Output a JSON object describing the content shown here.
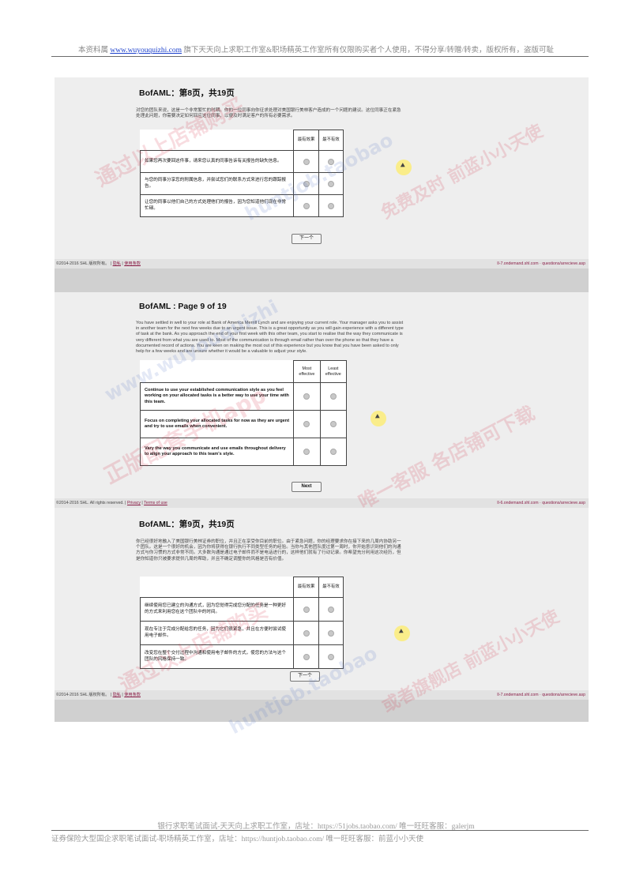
{
  "header": {
    "prefix": "本资料属",
    "link": "www.wuyouquizhi.com",
    "suffix": "旗下天天向上求职工作室&职场精英工作室所有仅限购买者个人使用，不得分享/转赠/转卖，版权所有，盗版可耻"
  },
  "shots": [
    {
      "title": "BofAML：第8页，共19页",
      "intro": "对您的团队来说，这是一个非常繁忙的时期。你的一位同事向你征求处理对美国银行美林客户造成的一个问题的建议。这位同事正在紧急处理此问题，你需要决定如何回应这位同事，以便及时满足客户的所有必要需求。",
      "col_most": "最有效果",
      "col_least": "最不有效",
      "options": [
        "如果您再次要回这件事，请来您认真的同事告诉有关报告的缺失信息。",
        "与您的同事分享您的附属信息，并尝试您们的联系方式来进行您的跟踪报告。",
        "让您的同事以他们自己的方式处理他们的报告，因为您知道他们现在非常忙碌。"
      ],
      "next": "下一个",
      "footer_left": "©2014-2016 SHL  版权所有。",
      "footer_privacy": "隐私",
      "footer_terms": "使用条款",
      "footer_right": "ll-7.ondemand.shl.com · questions/arrecieve.asp"
    },
    {
      "title": "BofAML : Page 9 of 19",
      "intro": "You have settled in well to your role at Bank of America Merrill Lynch and are enjoying your current role. Your manager asks you to assist in another team for the next few weeks due to an urgent issue. This is a great opportunity as you will gain experience with a different type of task at the bank. As you approach the end of your first week with this other team, you start to realise that the way they communicate is very different from what you are used to. Most of the communication is through email rather than over the phone so that they have a documented record of actions. You are keen on making the most out of this experience but you know that you have been asked to only help for a few weeks and are unsure whether it would be a valuable to adjust your style.",
      "col_most": "Most effective",
      "col_least": "Least effective",
      "options": [
        "Continue to use your established communication style as you feel working on your allocated tasks is a better way to use your time with this team.",
        "Focus on completing your allocated tasks for now as they are urgent and try to use emails when convenient.",
        "Vary the way you communicate and use emails throughout delivery to align your approach to this team's style."
      ],
      "next": "Next",
      "footer_left": "©2014-2016 SHL. All rights reserved.",
      "footer_privacy": "Privacy",
      "footer_terms": "Terms of use",
      "footer_right": "ll-6.ondemand.shl.com · questions/arrecieve.asp"
    },
    {
      "title": "BofAML：第9页，共19页",
      "intro": "你已经很好地融入了美国银行美林证券的职位，并且正在享受你目前的职位。由于紧急问题，你的经理要求你在接下来的几周内协助另一个团队。这是一个很好的机会，因为你将获得在银行执行不同类型任务的经验。当你与其他团队度过第一周时，你开始意识到他们的沟通方式与你习惯的方式非常不同。大多数沟通是通过电子邮件而不是电话进行的，这样他们就有了行动记录。你希望充分利用这次经历，但是你知道你只被要求提供几周的帮助，并且不确定调整你的风格是否有价值。",
      "col_most": "最有效果",
      "col_least": "最不有效",
      "options": [
        "继续使用您已建立的沟通方式，因为您觉得完成您分配的任务是一种更好的方式来利用您在这个团队中的时间。",
        "现在专注于完成分配给您的任务，因为它们很紧急，并且在方便时尝试使用电子邮件。",
        "改变您在整个交付过程中沟通和使用电子邮件的方式，使您的方法与这个团队的风格保持一致。"
      ],
      "next": "下一个",
      "footer_left": "©2014-2016 SHL  版权所有。",
      "footer_privacy": "隐私",
      "footer_terms": "使用条款",
      "footer_right": "ll-7.ondemand.shl.com · questions/arrecieve.asp"
    }
  ],
  "footer": {
    "line1": "银行求职笔试面试-天天向上求职工作室，店址：https://51jobs.taobao.com/ 唯一旺旺客服：galerjm",
    "line2": "证券保险大型国企求职笔试面试-职场精英工作室，店址：https://huntjob.taobao.com/ 唯一旺旺客服：前蓝小小天使"
  },
  "colors": {
    "link": "#1a3fcc",
    "footer_link": "#8a1e47",
    "watermark": "#d6283c",
    "cursor": "#fcec78"
  }
}
